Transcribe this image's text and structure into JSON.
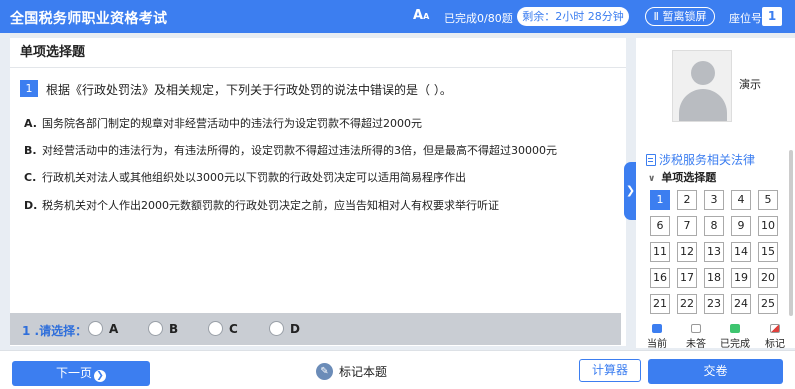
{
  "header": {
    "title": "全国税务师职业资格考试",
    "font_icon": "font-size-icon",
    "progress": "已完成0/80题",
    "timer": "剩余：2小时 28分钟",
    "lock": "Ⅱ 暂离锁屏",
    "seat_label": "座位号",
    "seat_number": "1"
  },
  "main": {
    "section_title": "单项选择题",
    "question_number": "1",
    "question_text": "根据《行政处罚法》及相关规定，下列关于行政处罚的说法中错误的是（   ）。",
    "options": [
      {
        "letter": "A.",
        "text": "国务院各部门制定的规章对非经营活动中的违法行为设定罚款不得超过2000元"
      },
      {
        "letter": "B.",
        "text": "对经营活动中的违法行为，有违法所得的，设定罚款不得超过违法所得的3倍，但是最高不得超过30000元"
      },
      {
        "letter": "C.",
        "text": "行政机关对法人或其他组织处以3000元以下罚款的行政处罚决定可以适用简易程序作出"
      },
      {
        "letter": "D.",
        "text": "税务机关对个人作出2000元数额罚款的行政处罚决定之前，应当告知相对人有权要求举行听证"
      }
    ],
    "answer_label": "1 .请选择：",
    "choices": [
      "A",
      "B",
      "C",
      "D"
    ]
  },
  "side_toggle": "❯",
  "right": {
    "user_name": "演示",
    "law_title": "涉税服务相关法律",
    "group_title": "单项选择题",
    "group_chevron": "∨",
    "current": "1",
    "question_numbers": [
      "1",
      "2",
      "3",
      "4",
      "5",
      "6",
      "7",
      "8",
      "9",
      "10",
      "11",
      "12",
      "13",
      "14",
      "15",
      "16",
      "17",
      "18",
      "19",
      "20",
      "21",
      "22",
      "23",
      "24",
      "25"
    ],
    "legend": [
      {
        "label": "当前",
        "color": "#3c7ef0"
      },
      {
        "label": "未答",
        "color": "#ffffff"
      },
      {
        "label": "已完成",
        "color": "#3ec56f"
      },
      {
        "label": "标记",
        "color": "#e0413d"
      }
    ]
  },
  "bottom": {
    "next_label": "下一页",
    "next_arrow": "❯",
    "mark_label": "标记本题",
    "mark_icon": "📌",
    "calc_label": "计算器",
    "submit_label": "交卷"
  }
}
